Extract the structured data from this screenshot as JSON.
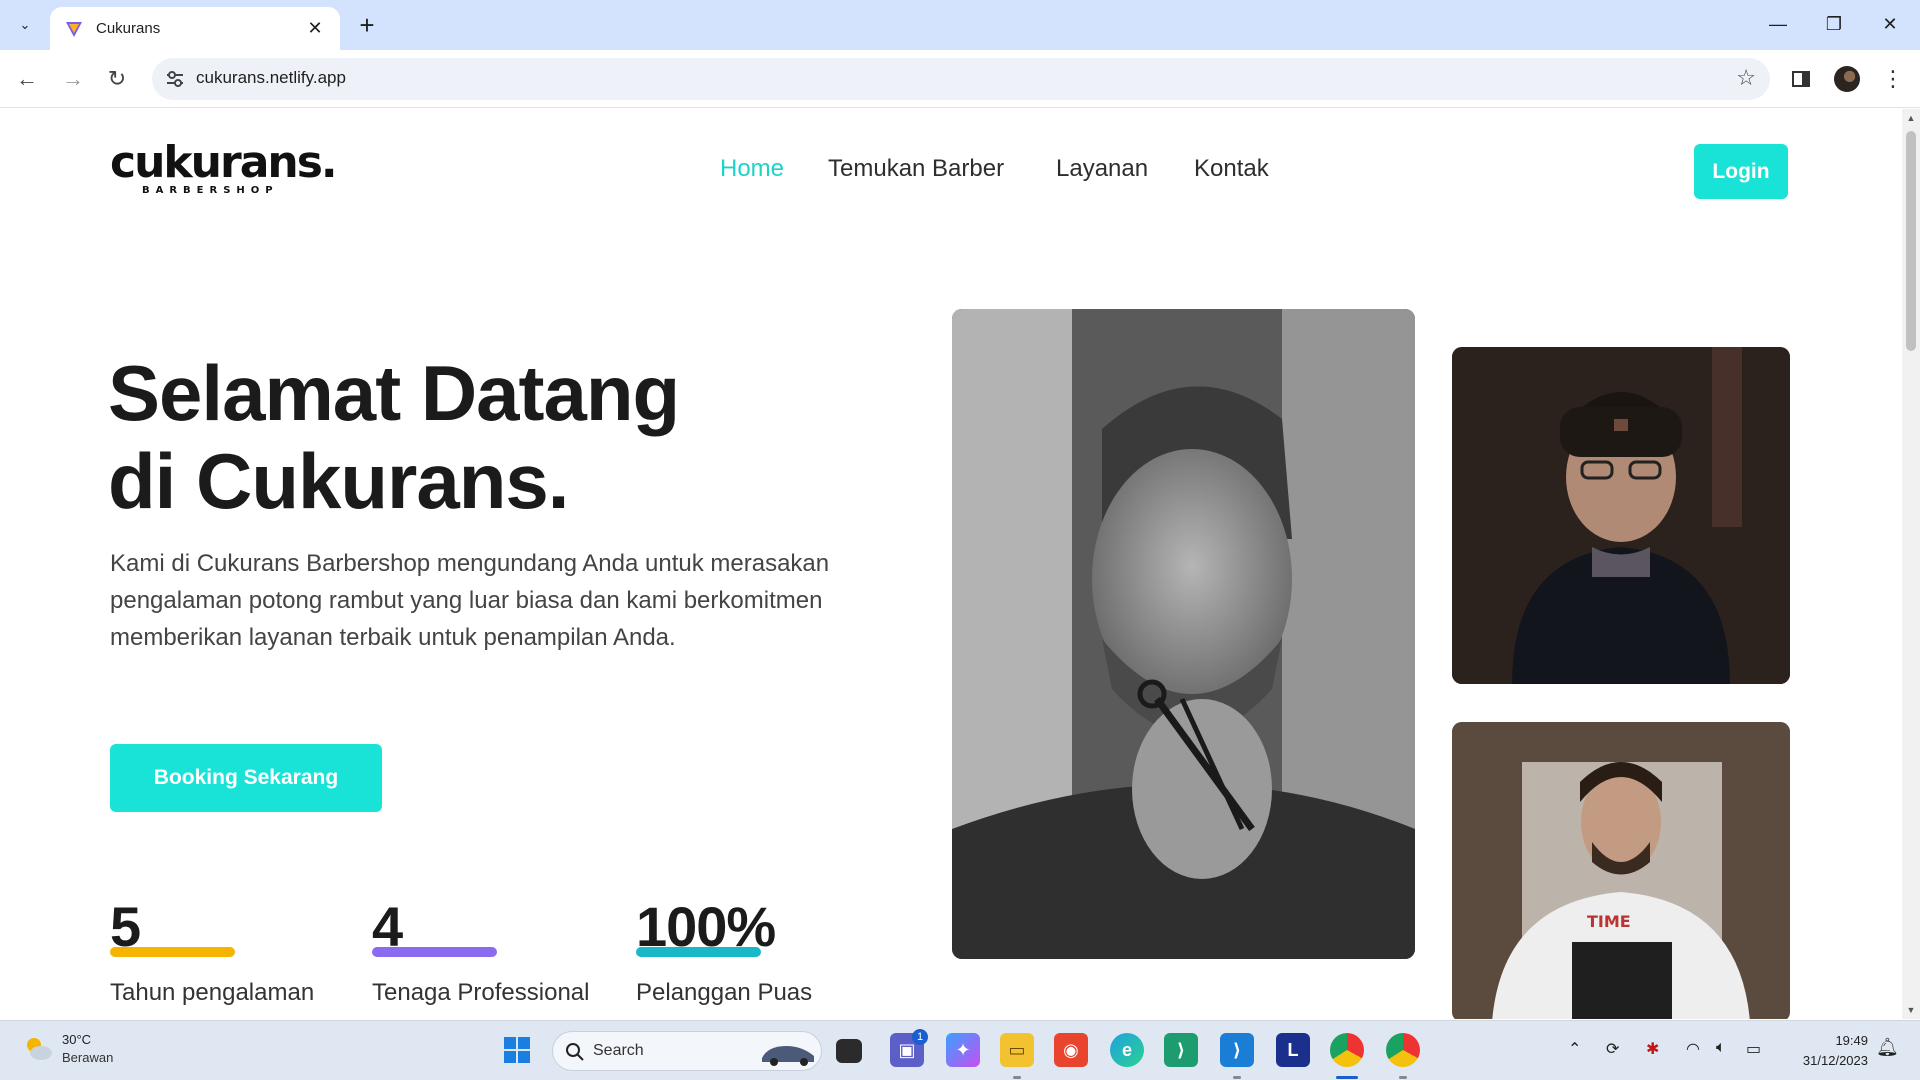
{
  "browser": {
    "tab_title": "Cukurans",
    "url": "cukurans.netlify.app"
  },
  "site": {
    "logo_word": "cukurans.",
    "logo_sub": "BARBERSHOP",
    "nav": [
      "Home",
      "Temukan Barber",
      "Layanan",
      "Kontak"
    ],
    "nav_active": "Home",
    "login_label": "Login",
    "hero_title_line1": "Selamat Datang",
    "hero_title_line2": "di Cukurans.",
    "hero_text": "Kami di Cukurans Barbershop mengundang Anda untuk merasakan pengalaman potong rambut yang luar biasa dan kami berkomitmen memberikan layanan terbaik untuk penampilan Anda.",
    "booking_label": "Booking Sekarang",
    "stats": [
      {
        "value": "5",
        "label": "Tahun pengalaman",
        "color": "#f5b400"
      },
      {
        "value": "4",
        "label": "Tenaga Professional",
        "color": "#8b6cf0"
      },
      {
        "value": "100%",
        "label": "Pelanggan Puas",
        "color": "#19b8c9"
      }
    ],
    "accent_color": "#19e3d6"
  },
  "taskbar": {
    "weather_temp": "30°C",
    "weather_cond": "Berawan",
    "search_label": "Search",
    "time": "19:49",
    "date": "31/12/2023",
    "chat_badge": "1"
  }
}
